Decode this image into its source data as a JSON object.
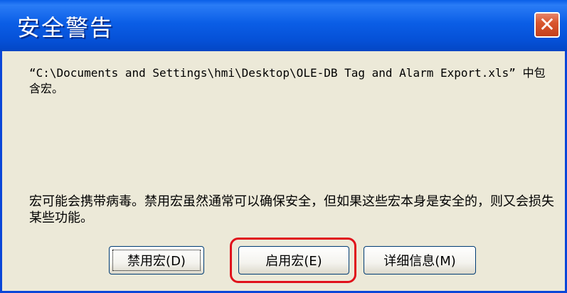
{
  "window": {
    "title": "安全警告",
    "close_glyph": "✕"
  },
  "message": {
    "file_notice": "“C:\\Documents and Settings\\hmi\\Desktop\\OLE-DB Tag and Alarm Export.xls” 中包含宏。",
    "warning": "宏可能会携带病毒。禁用宏虽然通常可以确保安全，但如果这些宏本身是安全的，则又会损失某些功能。"
  },
  "buttons": {
    "disable": "禁用宏(D)",
    "enable": "启用宏(E)",
    "details": "详细信息(M)"
  },
  "colors": {
    "titlebar": "#0550d6",
    "window_bg": "#ece9d8",
    "highlight": "#e0121b",
    "close_button": "#d9572f"
  }
}
